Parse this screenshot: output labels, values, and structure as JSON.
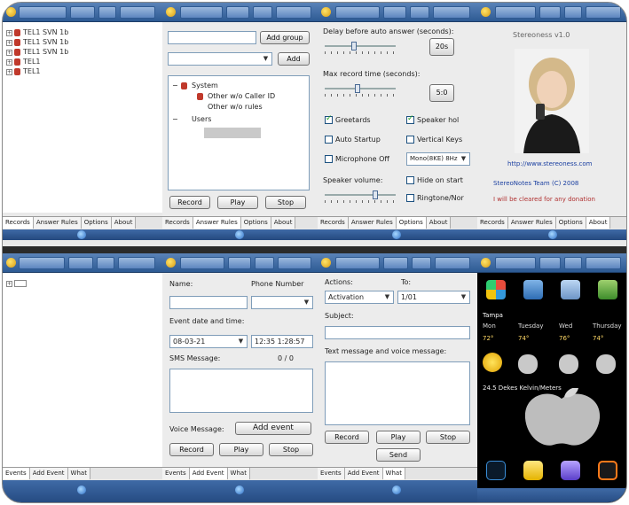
{
  "top_left": {
    "tree": [
      "TEL1 SVN 1b",
      "TEL1 SVN 1b",
      "TEL1 SVN 1b",
      "TEL1",
      "TEL1"
    ],
    "tabs": [
      "Records",
      "Answer Rules",
      "Options",
      "About"
    ]
  },
  "top_mid": {
    "add_group": "Add group",
    "add": "Add",
    "tree": {
      "system": "System",
      "item1": "Other w/o Caller ID",
      "item2": "Other w/o rules",
      "users": "Users"
    },
    "buttons": {
      "record": "Record",
      "play": "Play",
      "stop": "Stop"
    },
    "tabs": [
      "Records",
      "Answer Rules",
      "Options",
      "About"
    ]
  },
  "top_options": {
    "delay_label": "Delay before auto answer (seconds):",
    "delay_value": "20s",
    "maxrec_label": "Max record time (seconds):",
    "maxrec_value": "5:0",
    "checks": [
      {
        "label": "Greetards",
        "on": true
      },
      {
        "label": "Speaker hol",
        "on": true
      },
      {
        "label": "Auto Startup",
        "on": false
      },
      {
        "label": "Vertical Keys",
        "on": false
      },
      {
        "label": "Microphone Off",
        "on": false
      }
    ],
    "combo_value": "Mono(8KE) 8Hz",
    "speaker_label": "Speaker volume:",
    "c_hide": "Hide on start",
    "c_ringtone": "Ringtone/Nor",
    "tabs": [
      "Records",
      "Answer Rules",
      "Options",
      "About"
    ]
  },
  "top_about": {
    "title": "Stereoness v1.0",
    "url": "http://www.stereoness.com",
    "copyright": "StereoNotes Team (C) 2008",
    "note": "I will be cleared for any donation",
    "tabs": [
      "Records",
      "Answer Rules",
      "Options",
      "About"
    ]
  },
  "bottom_left": {
    "tabs": [
      "Events",
      "Add Event",
      "What"
    ]
  },
  "bottom_mid": {
    "name_label": "Name:",
    "phone_label": "Phone Number",
    "date_label": "Event date and time:",
    "date_value": "08-03-21",
    "time_value": "12:35  1:28:57",
    "sms_label": "SMS Message:",
    "sms_count": "0 / 0",
    "voice_label": "Voice Message:",
    "add_event": "Add event",
    "buttons": {
      "record": "Record",
      "play": "Play",
      "stop": "Stop"
    },
    "tabs": [
      "Events",
      "Add Event",
      "What"
    ]
  },
  "bottom_action": {
    "action_label": "Actions:",
    "to_label": "To:",
    "action_value": "Activation",
    "to_value": "1/01",
    "subject_label": "Subject:",
    "text_label": "Text message and voice message:",
    "buttons": {
      "record": "Record",
      "play": "Play",
      "stop": "Stop",
      "send": "Send"
    },
    "tabs": [
      "Events",
      "Add Event",
      "What"
    ]
  },
  "bottom_today": {
    "city": "Tampa",
    "days": [
      "Mon",
      "Tuesday",
      "Wed",
      "Thursday"
    ],
    "temps": [
      "72°",
      "74°",
      "76°",
      "74°"
    ],
    "fact": "24.5 Dekes Kelvin/Meters"
  }
}
